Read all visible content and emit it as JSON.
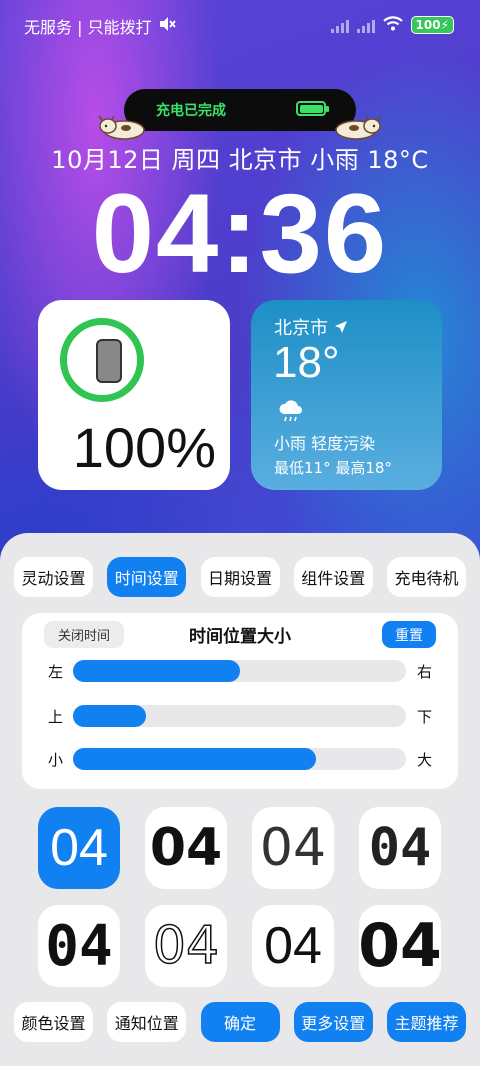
{
  "status_bar": {
    "carrier": "无服务 | 只能拨打",
    "battery": "100"
  },
  "island": {
    "text": "充电已完成"
  },
  "lock": {
    "date_line": "10月12日 周四 北京市  小雨  18°C",
    "time": "04:36"
  },
  "battery_widget": {
    "percent": "100%",
    "level": 1.0
  },
  "weather_widget": {
    "city": "北京市",
    "temp": "18°",
    "condition": "小雨 轻度污染",
    "range": "最低11°  最高18°"
  },
  "panel": {
    "tabs": [
      {
        "label": "灵动设置",
        "active": false
      },
      {
        "label": "时间设置",
        "active": true
      },
      {
        "label": "日期设置",
        "active": false
      },
      {
        "label": "组件设置",
        "active": false
      },
      {
        "label": "充电待机",
        "active": false
      }
    ],
    "card": {
      "close_time": "关闭时间",
      "title": "时间位置大小",
      "reset": "重置",
      "sliders": [
        {
          "left": "左",
          "right": "右",
          "value": 0.5
        },
        {
          "left": "上",
          "right": "下",
          "value": 0.22
        },
        {
          "left": "小",
          "right": "大",
          "value": 0.73
        }
      ]
    },
    "styles": [
      "04",
      "04",
      "04",
      "04",
      "04",
      "04",
      "04",
      "04"
    ],
    "bottom_buttons": [
      {
        "label": "颜色设置",
        "primary": false
      },
      {
        "label": "通知位置",
        "primary": false
      },
      {
        "label": "确定",
        "primary": true
      },
      {
        "label": "更多设置",
        "primary": true
      },
      {
        "label": "主题推荐",
        "primary": true
      }
    ]
  },
  "colors": {
    "accent": "#1180f0",
    "charge_green": "#3be26a",
    "battery_ring": "#30c552"
  }
}
